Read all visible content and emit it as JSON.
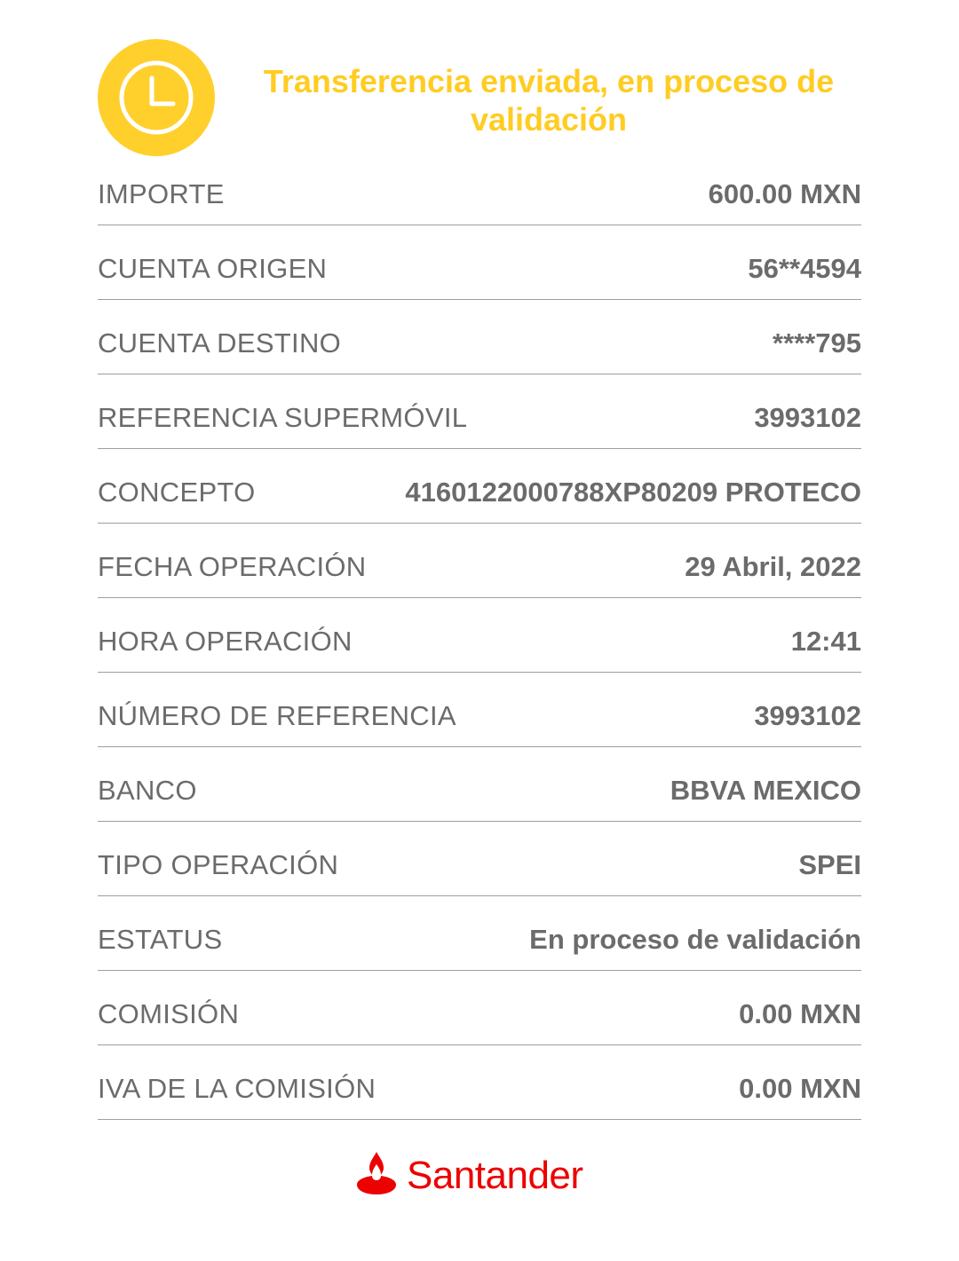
{
  "header": {
    "title": "Transferencia enviada, en proceso de validación",
    "status_icon": "clock-icon",
    "status_color": "#ffd02b"
  },
  "details": [
    {
      "label": "IMPORTE",
      "value": "600.00 MXN"
    },
    {
      "label": "CUENTA ORIGEN",
      "value": "56**4594"
    },
    {
      "label": "CUENTA DESTINO",
      "value": "****795"
    },
    {
      "label": "REFERENCIA SUPERMÓVIL",
      "value": "3993102"
    },
    {
      "label": "CONCEPTO",
      "value": "4160122000788XP80209 PROTECO"
    },
    {
      "label": "FECHA OPERACIÓN",
      "value": "29 Abril, 2022"
    },
    {
      "label": "HORA OPERACIÓN",
      "value": "12:41"
    },
    {
      "label": "NÚMERO DE REFERENCIA",
      "value": "3993102"
    },
    {
      "label": "BANCO",
      "value": "BBVA MEXICO"
    },
    {
      "label": "TIPO OPERACIÓN",
      "value": "SPEI"
    },
    {
      "label": "ESTATUS",
      "value": "En proceso de validación"
    },
    {
      "label": "COMISIÓN",
      "value": "0.00 MXN"
    },
    {
      "label": "IVA DE LA COMISIÓN",
      "value": "0.00 MXN"
    }
  ],
  "footer": {
    "brand": "Santander",
    "brand_icon": "santander-flame-icon",
    "brand_color": "#ec0000"
  }
}
